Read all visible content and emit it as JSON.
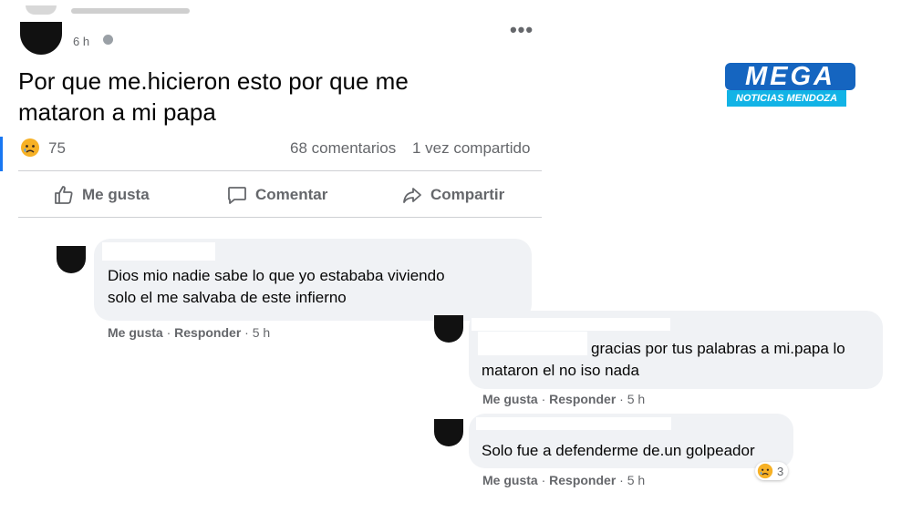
{
  "post": {
    "time": "6 h",
    "more": "•••",
    "text_line1": "Por que me.hicieron esto por que me",
    "text_line2": "mataron a mi papa",
    "reaction_count": "75",
    "comments_count": "68 comentarios",
    "shares_count": "1 vez compartido",
    "actions": {
      "like": "Me gusta",
      "comment": "Comentar",
      "share": "Compartir"
    }
  },
  "comments": [
    {
      "line1": "Dios mio nadie sabe lo que yo estababa viviendo",
      "line2": "solo el me salvaba de este infierno",
      "like": "Me gusta",
      "reply": "Responder",
      "time": "5 h"
    },
    {
      "line1": "gracias por tus palabras a mi.papa lo",
      "line2": "mataron el no iso nada",
      "like": "Me gusta",
      "reply": "Responder",
      "time": "5 h"
    },
    {
      "line1": "Solo fue a defenderme de.un golpeador",
      "like": "Me gusta",
      "reply": "Responder",
      "time": "5 h",
      "reaction_count": "3"
    }
  ],
  "logo": {
    "title": "MEGA",
    "subtitle": "NOTICIAS MENDOZA"
  },
  "colors": {
    "accent": "#1877f2",
    "bubble": "#f0f2f5",
    "muted_text": "#65676b",
    "logo_blue": "#1565c0",
    "logo_cyan": "#12b3e6"
  },
  "icons": [
    "sad-face-icon",
    "like-thumb-icon",
    "comment-bubble-icon",
    "share-arrow-icon",
    "globe-icon",
    "more-dots-icon"
  ]
}
